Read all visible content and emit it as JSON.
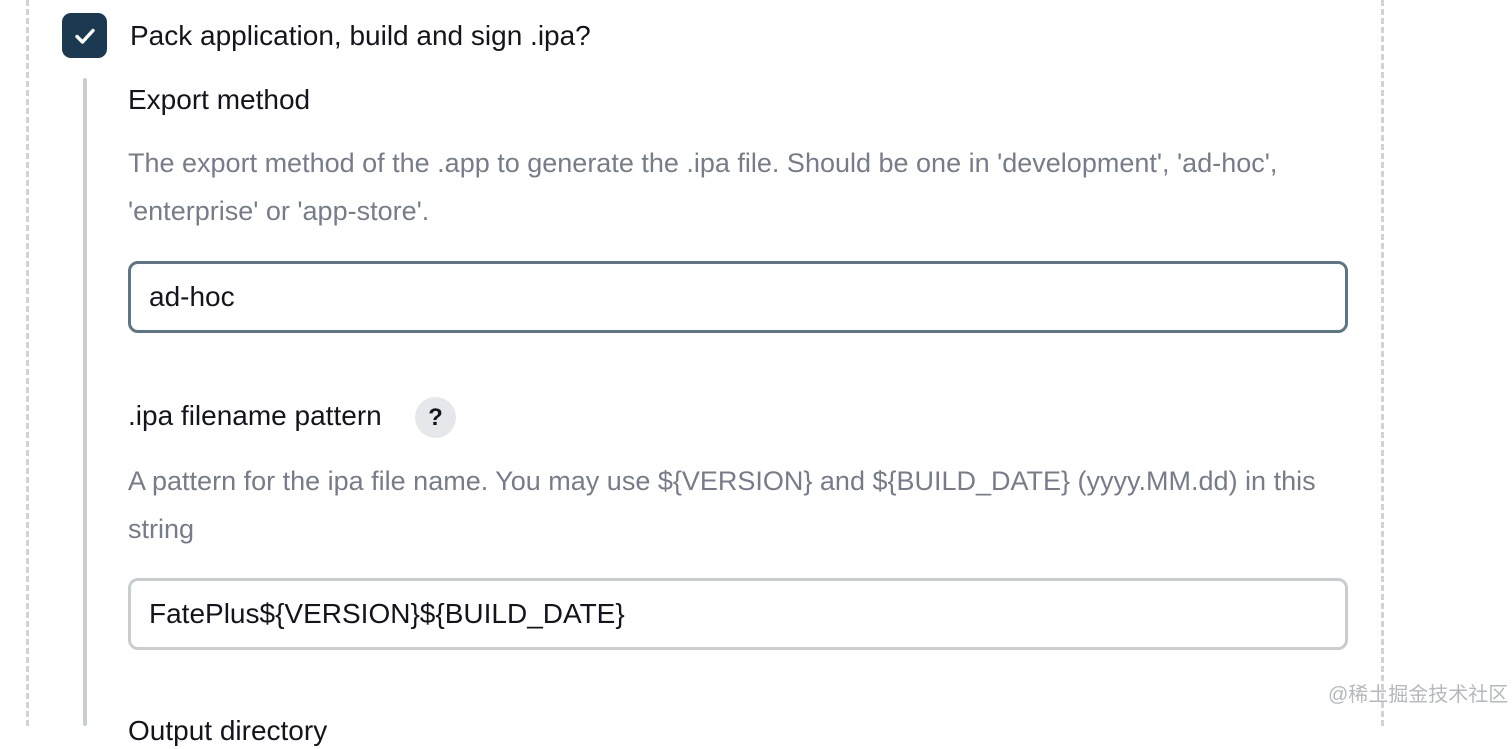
{
  "pack_section": {
    "checkbox_checked": true,
    "label": "Pack application, build and sign .ipa?"
  },
  "export_method": {
    "label": "Export method",
    "description": "The export method of the .app to generate the .ipa file. Should be one in 'development', 'ad-hoc', 'enterprise' or 'app-store'.",
    "value": "ad-hoc"
  },
  "ipa_filename": {
    "label": ".ipa filename pattern",
    "help_icon": "?",
    "description": "A pattern for the ipa file name. You may use ${VERSION} and ${BUILD_DATE} (yyyy.MM.dd) in this string",
    "value": "FatePlus${VERSION}${BUILD_DATE}"
  },
  "next_field": {
    "label": "Output directory"
  },
  "watermark": "@稀土掘金技术社区",
  "colors": {
    "checkbox_bg": "#1b3a52",
    "focused_border": "#5d7585",
    "input_border": "#c9ccd1",
    "description_text": "#777c8a",
    "dash_border": "#cfd2d8"
  }
}
